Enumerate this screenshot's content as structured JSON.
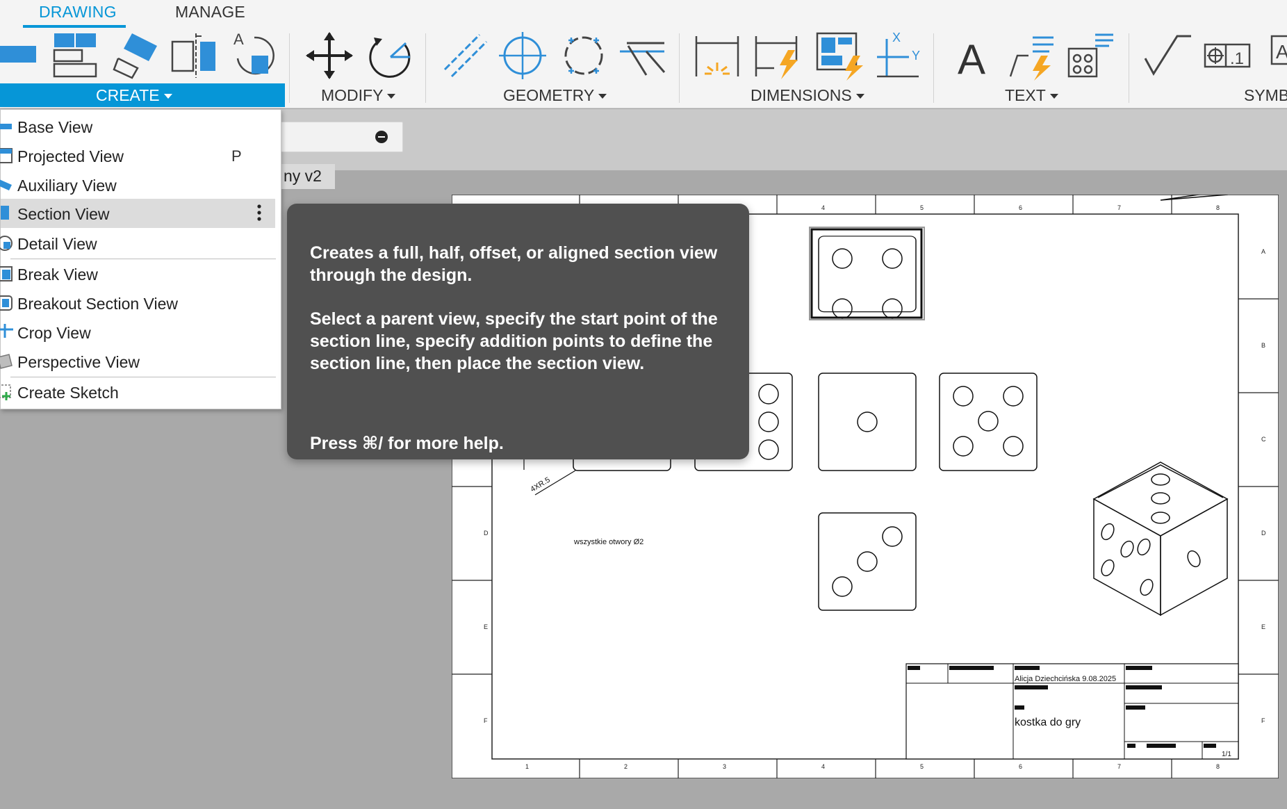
{
  "ribbon": {
    "tabs": [
      {
        "label": "DRAWING",
        "active": true
      },
      {
        "label": "MANAGE",
        "active": false
      }
    ],
    "groups": {
      "create": "CREATE",
      "modify": "MODIFY",
      "geometry": "GEOMETRY",
      "dimensions": "DIMENSIONS",
      "text": "TEXT",
      "symbols": "SYMBO"
    },
    "accent_color": "#0696d7"
  },
  "document_tab": "ny v2",
  "create_menu": {
    "items": [
      {
        "label": "Base View",
        "icon": "base-view-icon"
      },
      {
        "label": "Projected View",
        "shortcut": "P",
        "icon": "projected-view-icon"
      },
      {
        "label": "Auxiliary View",
        "icon": "auxiliary-view-icon"
      },
      {
        "label": "Section View",
        "icon": "section-view-icon",
        "hovered": true
      },
      {
        "label": "Detail View",
        "icon": "detail-view-icon"
      },
      {
        "label": "Break View",
        "icon": "break-view-icon"
      },
      {
        "label": "Breakout Section View",
        "icon": "breakout-section-view-icon"
      },
      {
        "label": "Crop View",
        "icon": "crop-view-icon"
      },
      {
        "label": "Perspective View",
        "icon": "perspective-view-icon"
      },
      {
        "label": "Create Sketch",
        "icon": "create-sketch-icon"
      }
    ]
  },
  "tooltip": {
    "para1": "Creates a full, half, offset, or aligned section view through the design.",
    "para2": "Select a parent view, specify the start point of the section line, specify addition points to define the section line, then place the section view.",
    "help": "Press ⌘/ for more help."
  },
  "sheet": {
    "zone_numbers": [
      "1",
      "2",
      "3",
      "4",
      "5",
      "6",
      "7",
      "8"
    ],
    "zone_letters": [
      "A",
      "B",
      "C",
      "D",
      "E",
      "F"
    ],
    "dimension_note": "4XR.5",
    "holes_note": "wszystkie otwory Ø2",
    "title_block": {
      "author_date": "Alicja Dziechcińska 9.08.2025",
      "title": "kostka do gry",
      "sheet_no": "1/1"
    }
  }
}
